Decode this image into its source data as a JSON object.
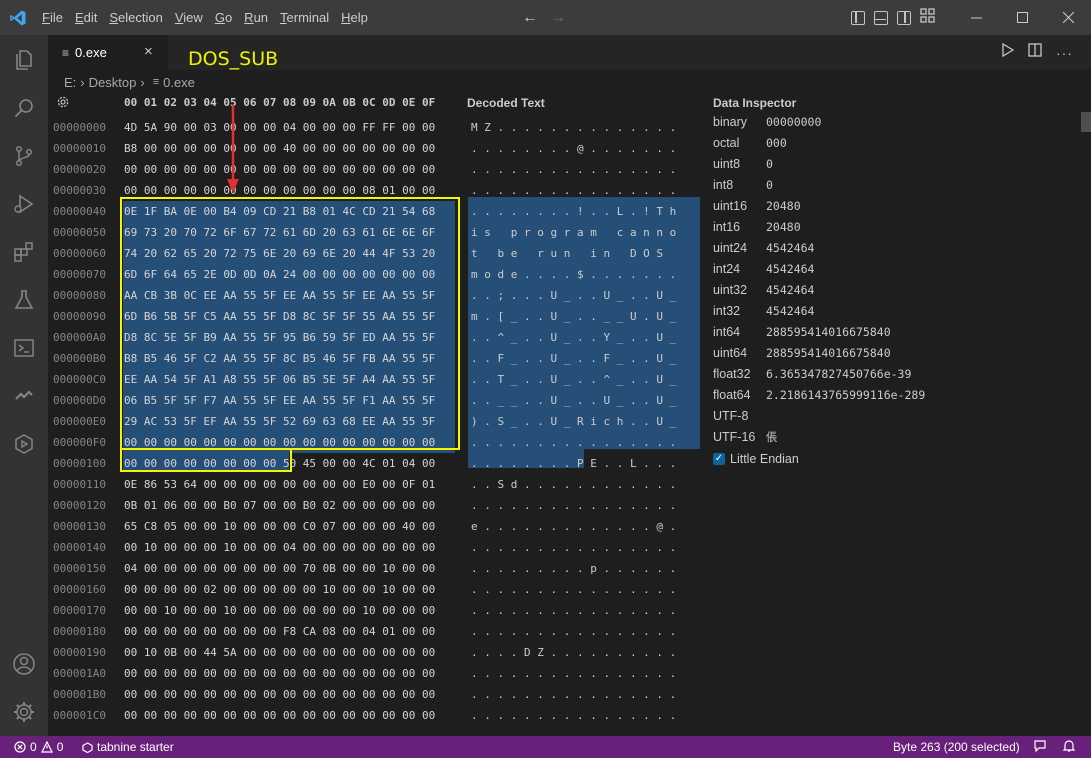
{
  "window": {
    "menus": [
      {
        "pre": "",
        "u": "F",
        "post": "ile"
      },
      {
        "pre": "",
        "u": "E",
        "post": "dit"
      },
      {
        "pre": "",
        "u": "S",
        "post": "election"
      },
      {
        "pre": "",
        "u": "V",
        "post": "iew"
      },
      {
        "pre": "",
        "u": "G",
        "post": "o"
      },
      {
        "pre": "",
        "u": "R",
        "post": "un"
      },
      {
        "pre": "",
        "u": "T",
        "post": "erminal"
      },
      {
        "pre": "",
        "u": "H",
        "post": "elp"
      }
    ]
  },
  "tab": {
    "label": "0.exe",
    "close": "×"
  },
  "breadcrumb": {
    "drive": "E:",
    "folder": "Desktop",
    "file": "0.exe",
    "sep": "›"
  },
  "hex": {
    "header": "00 01 02 03 04 05 06 07 08 09 0A 0B 0C 0D 0E 0F",
    "offsets": [
      "00000000",
      "00000010",
      "00000020",
      "00000030",
      "00000040",
      "00000050",
      "00000060",
      "00000070",
      "00000080",
      "00000090",
      "000000A0",
      "000000B0",
      "000000C0",
      "000000D0",
      "000000E0",
      "000000F0",
      "00000100",
      "00000110",
      "00000120",
      "00000130",
      "00000140",
      "00000150",
      "00000160",
      "00000170",
      "00000180",
      "00000190",
      "000001A0",
      "000001B0",
      "000001C0"
    ],
    "rows": [
      "4D 5A 90 00 03 00 00 00 04 00 00 00 FF FF 00 00",
      "B8 00 00 00 00 00 00 00 40 00 00 00 00 00 00 00",
      "00 00 00 00 00 00 00 00 00 00 00 00 00 00 00 00",
      "00 00 00 00 00 00 00 00 00 00 00 00 08 01 00 00",
      "0E 1F BA 0E 00 B4 09 CD 21 B8 01 4C CD 21 54 68",
      "69 73 20 70 72 6F 67 72 61 6D 20 63 61 6E 6E 6F",
      "74 20 62 65 20 72 75 6E 20 69 6E 20 44 4F 53 20",
      "6D 6F 64 65 2E 0D 0D 0A 24 00 00 00 00 00 00 00",
      "AA CB 3B 0C EE AA 55 5F EE AA 55 5F EE AA 55 5F",
      "6D B6 5B 5F C5 AA 55 5F D8 8C 5F 5F 55 AA 55 5F",
      "D8 8C 5E 5F B9 AA 55 5F 95 B6 59 5F ED AA 55 5F",
      "B8 B5 46 5F C2 AA 55 5F 8C B5 46 5F FB AA 55 5F",
      "EE AA 54 5F A1 A8 55 5F 06 B5 5E 5F A4 AA 55 5F",
      "06 B5 5F 5F F7 AA 55 5F EE AA 55 5F F1 AA 55 5F",
      "29 AC 53 5F EF AA 55 5F 52 69 63 68 EE AA 55 5F",
      "00 00 00 00 00 00 00 00 00 00 00 00 00 00 00 00",
      "00 00 00 00 00 00 00 00 50 45 00 00 4C 01 04 00",
      "0E 86 53 64 00 00 00 00 00 00 00 00 E0 00 0F 01",
      "0B 01 06 00 00 B0 07 00 00 B0 02 00 00 00 00 00",
      "65 C8 05 00 00 10 00 00 00 C0 07 00 00 00 40 00",
      "00 10 00 00 00 10 00 00 04 00 00 00 00 00 00 00",
      "04 00 00 00 00 00 00 00 00 70 0B 00 00 10 00 00",
      "00 00 00 00 02 00 00 00 00 00 10 00 00 10 00 00",
      "00 00 10 00 00 10 00 00 00 00 00 00 10 00 00 00",
      "00 00 00 00 00 00 00 00 F8 CA 08 00 04 01 00 00",
      "00 10 0B 00 44 5A 00 00 00 00 00 00 00 00 00 00",
      "00 00 00 00 00 00 00 00 00 00 00 00 00 00 00 00",
      "00 00 00 00 00 00 00 00 00 00 00 00 00 00 00 00",
      "00 00 00 00 00 00 00 00 00 00 00 00 00 00 00 00"
    ]
  },
  "decoded": {
    "title": "Decoded Text",
    "rows": [
      "M Z . . . . . . . . . . . . . .",
      ". . . . . . . . @ . . . . . . .",
      ". . . . . . . . . . . . . . . .",
      ". . . . . . . . . . . . . . . .",
      ". . . . . . . . ! . . L . ! T h",
      "i s   p r o g r a m   c a n n o",
      "t   b e   r u n   i n   D O S  ",
      "m o d e . . . . $ . . . . . . .",
      ". . ; . . . U _ . . U _ . . U _",
      "m . [ _ . . U _ . . _ _ U . U _",
      ". . ^ _ . . U _ . . Y _ . . U _",
      ". . F _ . . U _ . . F _ . . U _",
      ". . T _ . . U _ . . ^ _ . . U _",
      ". . _ _ . . U _ . . U _ . . U _",
      ") . S _ . . U _ R i c h . . U _",
      ". . . . . . . . . . . . . . . .",
      ". . . . . . . . P E . . L . . .",
      ". . S d . . . . . . . . . . . .",
      ". . . . . . . . . . . . . . . .",
      "e . . . . . . . . . . . . . @ .",
      ". . . . . . . . . . . . . . . .",
      ". . . . . . . . . p . . . . . .",
      ". . . . . . . . . . . . . . . .",
      ". . . . . . . . . . . . . . . .",
      ". . . . . . . . . . . . . . . .",
      ". . . . D Z . . . . . . . . . .",
      ". . . . . . . . . . . . . . . .",
      ". . . . . . . . . . . . . . . .",
      ". . . . . . . . . . . . . . . ."
    ]
  },
  "inspector": {
    "title": "Data Inspector",
    "rows": [
      {
        "label": "binary",
        "value": "00000000"
      },
      {
        "label": "octal",
        "value": "000"
      },
      {
        "label": "uint8",
        "value": "0"
      },
      {
        "label": "int8",
        "value": "0"
      },
      {
        "label": "uint16",
        "value": "20480"
      },
      {
        "label": "int16",
        "value": "20480"
      },
      {
        "label": "uint24",
        "value": "4542464"
      },
      {
        "label": "int24",
        "value": "4542464"
      },
      {
        "label": "uint32",
        "value": "4542464"
      },
      {
        "label": "int32",
        "value": "4542464"
      },
      {
        "label": "int64",
        "value": "288595414016675840"
      },
      {
        "label": "uint64",
        "value": "288595414016675840"
      },
      {
        "label": "float32",
        "value": "6.365347827450766e-39"
      },
      {
        "label": "float64",
        "value": "2.2186143765999116e-289"
      },
      {
        "label": "UTF-8",
        "value": ""
      },
      {
        "label": "UTF-16",
        "value": "倀"
      }
    ],
    "endian_label": "Little Endian",
    "endian_checked": true
  },
  "annotation": {
    "label": "DOS_SUB",
    "color": "#f2f200",
    "arrow_color": "#e23030"
  },
  "status": {
    "errors": "0",
    "warnings": "0",
    "tabnine": "tabnine starter",
    "selection": "Byte 263 (200 selected)"
  },
  "colors": {
    "status_bar": "#68217a",
    "selection": "#264f78",
    "accent_blue": "#0e639c"
  }
}
